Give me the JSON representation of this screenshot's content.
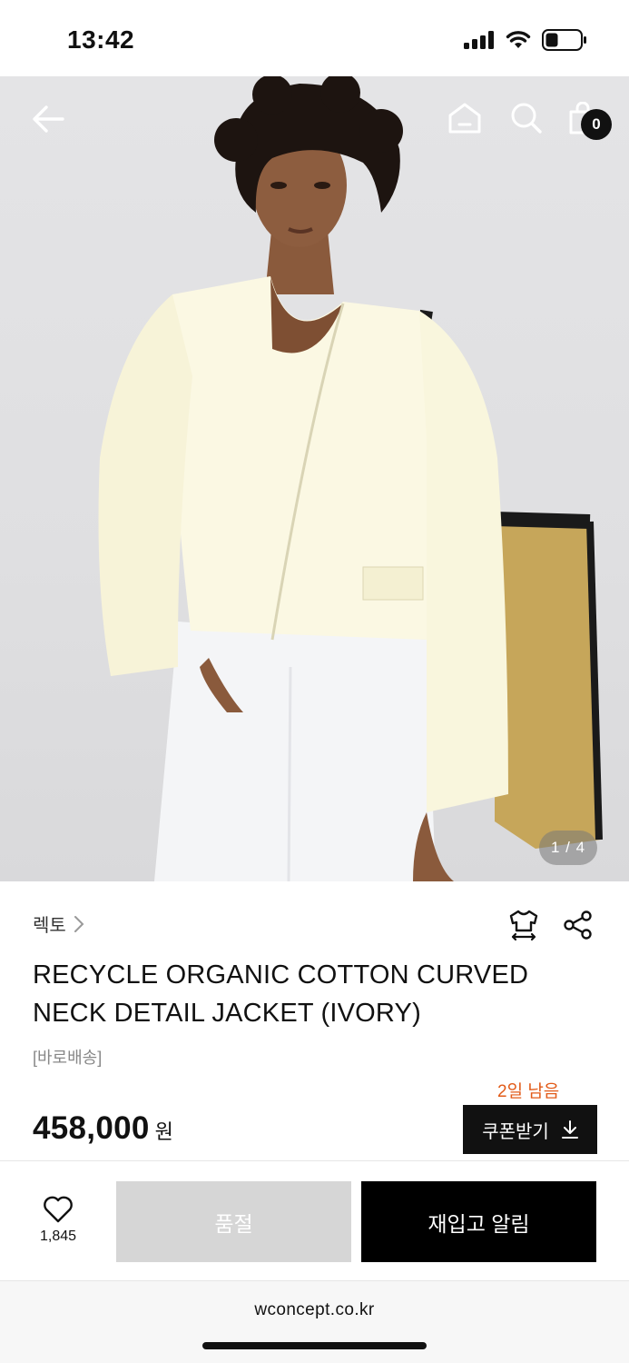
{
  "status_bar": {
    "time": "13:42",
    "icons": [
      "signal-icon",
      "wifi-icon",
      "battery-icon"
    ]
  },
  "nav": {
    "icons": [
      "back-arrow-icon",
      "home-icon",
      "search-icon",
      "shopping-bag-icon"
    ],
    "cart_count": "0"
  },
  "gallery": {
    "counter": "1 / 4"
  },
  "product": {
    "brand": "렉토",
    "title": "RECYCLE ORGANIC COTTON CURVED NECK DETAIL JACKET (IVORY)",
    "delivery_tag": "[바로배송]",
    "price": "458,000",
    "currency": "원",
    "coupon_days_left": "2일 남음",
    "coupon_button": "쿠폰받기"
  },
  "actions": {
    "wish_count": "1,845",
    "soldout_label": "품절",
    "restock_label": "재입고 알림"
  },
  "browser": {
    "url": "wconcept.co.kr"
  },
  "colors": {
    "accent_orange": "#e25b19",
    "primary_black": "#000000",
    "disabled_gray": "#d6d6d6"
  }
}
